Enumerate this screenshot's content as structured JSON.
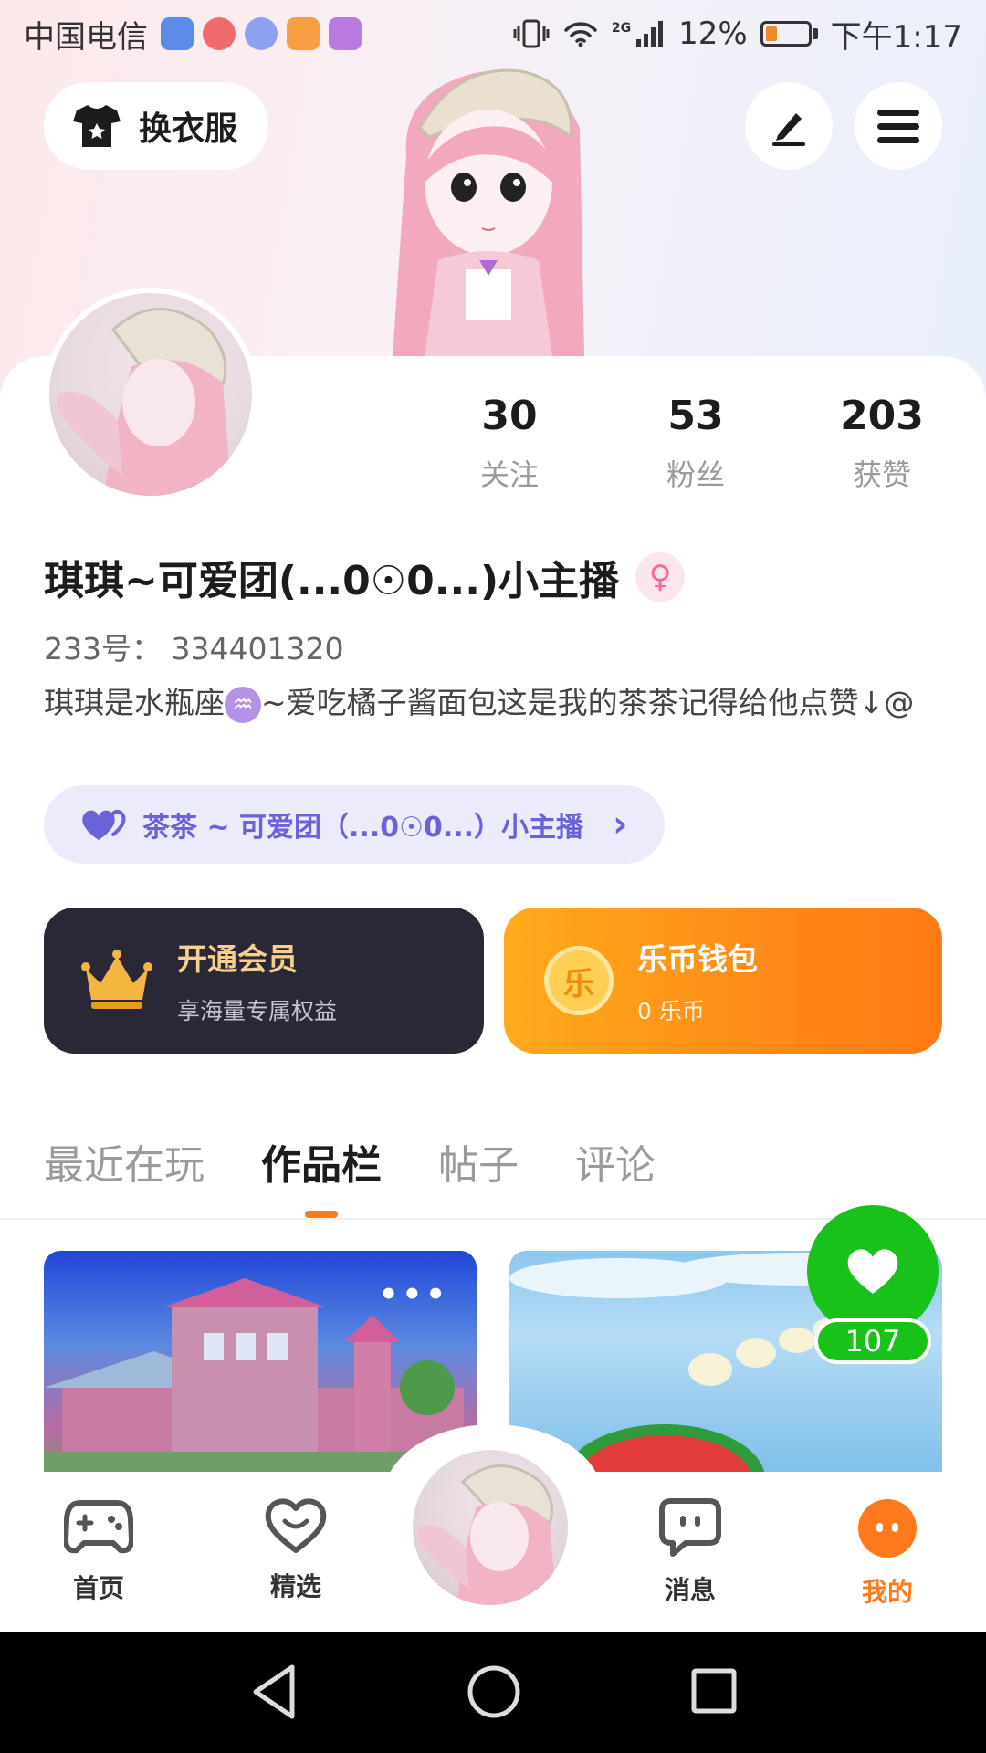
{
  "status_bar": {
    "carrier": "中国电信",
    "signal_label": "2G",
    "battery": "12%",
    "time": "下午1:17"
  },
  "header": {
    "dress_button": "换衣服"
  },
  "stats": [
    {
      "value": "30",
      "label": "关注"
    },
    {
      "value": "53",
      "label": "粉丝"
    },
    {
      "value": "203",
      "label": "获赞"
    }
  ],
  "profile": {
    "name": "琪琪~可爱团(...0☉0...)小主播",
    "gender_symbol": "♀",
    "uid": "233号：  334401320",
    "bio_before": "琪琪是水瓶座",
    "bio_zodiac": "♒",
    "bio_after": "~爱吃橘子酱面包这是我的茶茶记得给他点赞↓@",
    "tea_pill": "茶茶 ~ 可爱团（...0☉0...）小主播",
    "tea_chevron": "›"
  },
  "promos": {
    "vip_title": "开通会员",
    "vip_sub": "享海量专属权益",
    "coin_title": "乐币钱包",
    "coin_sub": "0 乐币",
    "coin_glyph": "乐"
  },
  "tabs": [
    "最近在玩",
    "作品栏",
    "帖子",
    "评论"
  ],
  "active_tab": "作品栏",
  "works": {
    "more_label": "•••",
    "like_count": "107"
  },
  "bottom_nav": [
    {
      "label": "首页",
      "icon": "gamepad-icon"
    },
    {
      "label": "精选",
      "icon": "heart-outline-icon"
    },
    {
      "label": "",
      "icon": "avatar"
    },
    {
      "label": "消息",
      "icon": "chat-icon"
    },
    {
      "label": "我的",
      "icon": "me-icon"
    }
  ],
  "colors": {
    "accent": "#ff7a1c",
    "like_green": "#19c21a",
    "tea_purple": "#6b62d8"
  }
}
